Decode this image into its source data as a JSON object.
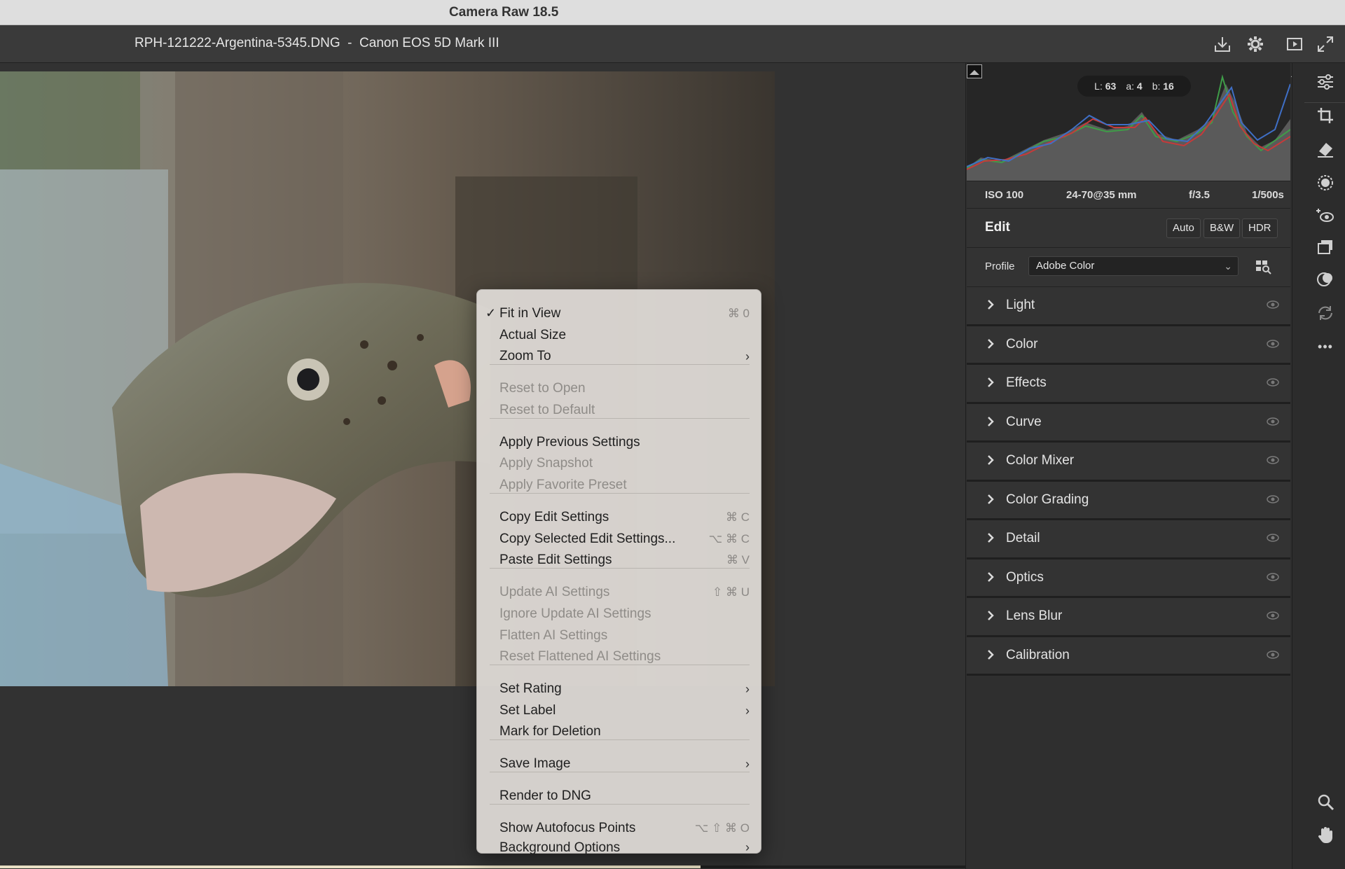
{
  "window": {
    "title": "Camera Raw 18.5"
  },
  "header": {
    "filename": "RPH-121222-Argentina-5345.DNG  -  Canon EOS 5D Mark III",
    "icons": [
      "save-icon",
      "gear-icon",
      "fullscreen-preview-icon",
      "expand-icon"
    ]
  },
  "histogram": {
    "lab": {
      "l_label": "L:",
      "l_value": "63",
      "a_label": "a:",
      "a_value": "4",
      "b_label": "b:",
      "b_value": "16"
    }
  },
  "exif": {
    "iso": "ISO 100",
    "lens": "24-70@35 mm",
    "aperture": "f/3.5",
    "shutter": "1/500s"
  },
  "edit": {
    "title": "Edit",
    "auto_label": "Auto",
    "bw_label": "B&W",
    "hdr_label": "HDR",
    "profile_label": "Profile",
    "profile_value": "Adobe Color"
  },
  "sections": [
    {
      "label": "Light"
    },
    {
      "label": "Color"
    },
    {
      "label": "Effects"
    },
    {
      "label": "Curve"
    },
    {
      "label": "Color Mixer"
    },
    {
      "label": "Color Grading"
    },
    {
      "label": "Detail"
    },
    {
      "label": "Optics"
    },
    {
      "label": "Lens Blur"
    },
    {
      "label": "Calibration"
    }
  ],
  "toolbar": {
    "icons": [
      "edit-sliders-icon",
      "crop-icon",
      "eraser-icon",
      "masking-icon",
      "red-eye-icon",
      "snapshots-icon",
      "presets-icon",
      "sync-icon",
      "more-icon",
      "zoom-icon",
      "hand-icon"
    ],
    "more_label": "•••"
  },
  "context_menu": {
    "items": [
      {
        "label": "Fit in View",
        "shortcut": "⌘ 0",
        "checked": "✓",
        "disabled": false
      },
      {
        "label": "Actual Size",
        "shortcut": "",
        "disabled": false
      },
      {
        "label": "Zoom To",
        "submenu": "›",
        "disabled": false
      },
      {
        "label": "Reset to Open",
        "disabled": true
      },
      {
        "label": "Reset to Default",
        "disabled": true
      },
      {
        "label": "Apply Previous Settings",
        "disabled": false
      },
      {
        "label": "Apply Snapshot",
        "disabled": true
      },
      {
        "label": "Apply Favorite Preset",
        "disabled": true
      },
      {
        "label": "Copy Edit Settings",
        "shortcut": "⌘ C",
        "disabled": false
      },
      {
        "label": "Copy Selected Edit Settings...",
        "shortcut": "⌥ ⌘ C",
        "disabled": false
      },
      {
        "label": "Paste Edit Settings",
        "shortcut": "⌘ V",
        "disabled": false
      },
      {
        "label": "Update AI Settings",
        "shortcut": "⇧ ⌘ U",
        "disabled": true
      },
      {
        "label": "Ignore Update AI Settings",
        "disabled": true
      },
      {
        "label": "Flatten AI Settings",
        "disabled": true
      },
      {
        "label": "Reset Flattened AI Settings",
        "disabled": true
      },
      {
        "label": "Set Rating",
        "submenu": "›",
        "disabled": false
      },
      {
        "label": "Set Label",
        "submenu": "›",
        "disabled": false
      },
      {
        "label": "Mark for Deletion",
        "disabled": false
      },
      {
        "label": "Save Image",
        "submenu": "›",
        "disabled": false
      },
      {
        "label": "Render to DNG",
        "disabled": false
      },
      {
        "label": "Show Autofocus Points",
        "shortcut": "⌥ ⇧ ⌘ O",
        "disabled": false
      },
      {
        "label": "Background Options",
        "submenu": "›",
        "disabled": false
      }
    ]
  },
  "colors": {
    "accent": "#e6e6e6",
    "panel": "#333333",
    "menu_bg": "#e1ddd8"
  }
}
